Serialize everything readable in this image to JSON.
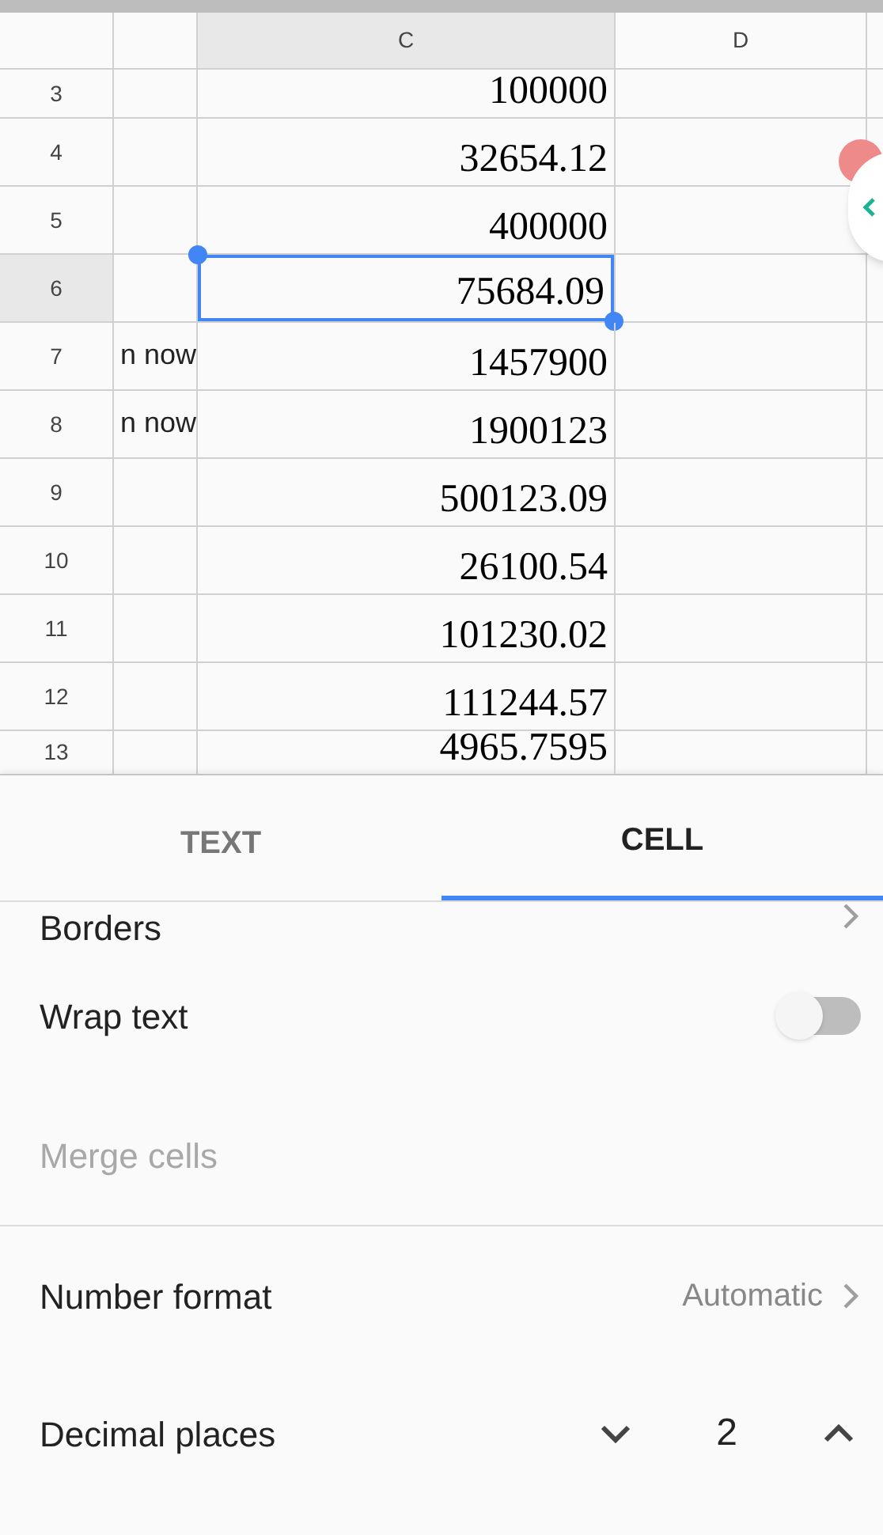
{
  "sheet": {
    "columns": [
      {},
      {
        "label": "C"
      },
      {
        "label": "D"
      }
    ],
    "rows": [
      {
        "number": "3",
        "col_c": "100000",
        "selected": false
      },
      {
        "number": "4",
        "col_c": "32654.12",
        "selected": false
      },
      {
        "number": "5",
        "col_c": "400000",
        "selected": false
      },
      {
        "number": "6",
        "col_c": "75684.09",
        "selected": true
      },
      {
        "number": "7",
        "col_b": "n now",
        "col_c": "1457900",
        "selected": false
      },
      {
        "number": "8",
        "col_b": "n now",
        "col_c": "1900123",
        "selected": false
      },
      {
        "number": "9",
        "col_c": "500123.09",
        "selected": false
      },
      {
        "number": "10",
        "col_c": "26100.54",
        "selected": false
      },
      {
        "number": "11",
        "col_c": "101230.02",
        "selected": false
      },
      {
        "number": "12",
        "col_c": "111244.57",
        "selected": false
      },
      {
        "number": "13",
        "col_c": "4965.7595",
        "selected": false
      }
    ]
  },
  "panel": {
    "tabs": [
      {
        "label": "TEXT",
        "selected": false
      },
      {
        "label": "CELL",
        "selected": true
      }
    ],
    "items": [
      {
        "kind": "link",
        "label": "Borders",
        "disabled": false
      },
      {
        "kind": "toggle",
        "label": "Wrap text",
        "on": false,
        "disabled": false
      },
      {
        "kind": "plain",
        "label": "Merge cells",
        "disabled": true
      },
      {
        "kind": "divider"
      },
      {
        "kind": "value",
        "label": "Number format",
        "value": "Automatic",
        "disabled": false
      },
      {
        "kind": "stepper",
        "label": "Decimal places",
        "value": "2",
        "disabled": false
      }
    ]
  }
}
